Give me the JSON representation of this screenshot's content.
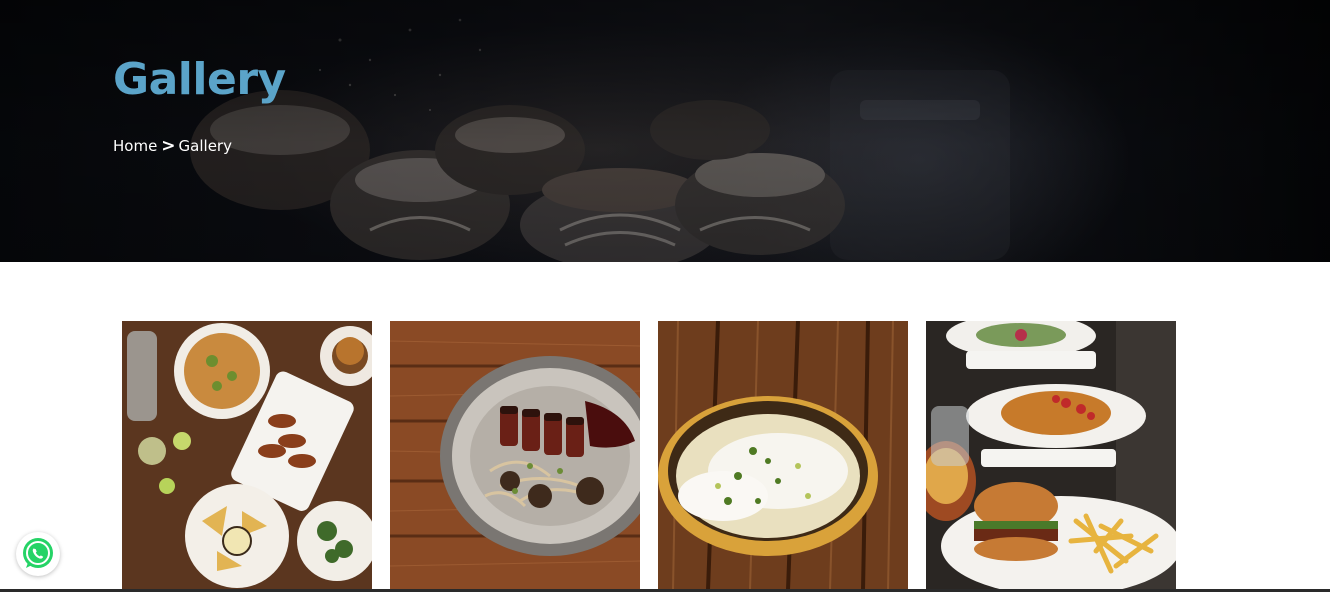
{
  "hero": {
    "title": "Gallery",
    "breadcrumb": {
      "home": "Home",
      "separator": ">",
      "current": "Gallery"
    }
  },
  "gallery": {
    "images": [
      {
        "subject": "table spread with salads, wings, nachos and burger"
      },
      {
        "subject": "sliced steak with slaw on grey plate over wooden boards"
      },
      {
        "subject": "creamy dish with pistachios in golden bowl on wooden table"
      },
      {
        "subject": "restaurant table with burger and fries, pancakes and salad"
      }
    ]
  },
  "floating": {
    "icon": "whatsapp-icon"
  },
  "colors": {
    "title": "#5ba4c9",
    "hero_bg": "#0c0e13",
    "whatsapp": "#25d366"
  }
}
